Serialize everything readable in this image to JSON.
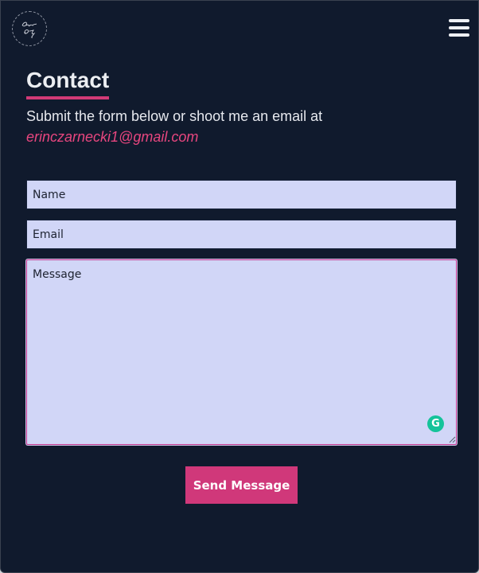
{
  "header": {
    "logo_icon": "signature-logo-icon",
    "menu_icon": "hamburger-menu-icon"
  },
  "contact": {
    "title": "Contact",
    "intro": "Submit the form below or shoot me an email at",
    "email": "erinczarnecki1@gmail.com"
  },
  "form": {
    "name_placeholder": "Name",
    "email_placeholder": "Email",
    "message_placeholder": "Message",
    "send_label": "Send Message",
    "grammarly_icon": "grammarly-icon",
    "grammarly_glyph": "G"
  },
  "colors": {
    "background": "#101a2d",
    "accent": "#d0387a",
    "field": "#d1d6f7"
  }
}
